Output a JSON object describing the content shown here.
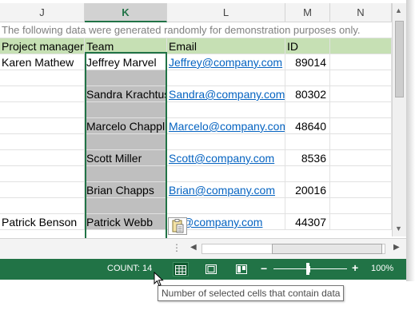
{
  "columns": [
    {
      "letter": "J",
      "selected": false
    },
    {
      "letter": "K",
      "selected": true
    },
    {
      "letter": "L",
      "selected": false
    },
    {
      "letter": "M",
      "selected": false
    },
    {
      "letter": "N",
      "selected": false
    }
  ],
  "note": "The following data were generated randomly for demonstration purposes only.",
  "headers": {
    "project_manager": "Project manager",
    "team": "Team",
    "email": "Email",
    "id": "ID"
  },
  "rows": [
    {
      "pm": "Karen Mathew",
      "team": "Jeffrey Marvel",
      "email": "Jeffrey@company.com",
      "id": "89014"
    },
    {
      "pm": "",
      "team": "",
      "email": "",
      "id": ""
    },
    {
      "pm": "",
      "team": "Sandra Krachtus",
      "email": "Sandra@company.com",
      "id": "80302"
    },
    {
      "pm": "",
      "team": "",
      "email": "",
      "id": ""
    },
    {
      "pm": "",
      "team": "Marcelo Chappl",
      "email": "Marcelo@company.com",
      "id": "48640"
    },
    {
      "pm": "",
      "team": "",
      "email": "",
      "id": ""
    },
    {
      "pm": "",
      "team": "Scott Miller",
      "email": "Scott@company.com",
      "id": "8536"
    },
    {
      "pm": "",
      "team": "",
      "email": "",
      "id": ""
    },
    {
      "pm": "",
      "team": "Brian Chapps",
      "email": "Brian@company.com",
      "id": "20016"
    },
    {
      "pm": "",
      "team": "",
      "email": "",
      "id": ""
    },
    {
      "pm": "Patrick Benson",
      "team": "Patrick Webb",
      "email": "ick@company.com",
      "id": "44307"
    }
  ],
  "status_bar": {
    "count": "COUNT: 14",
    "zoom": "100%",
    "zoom_minus": "−",
    "zoom_plus": "+",
    "accent_color": "#217346"
  },
  "tooltip": "Number of selected cells that contain data",
  "icons": {
    "normal_view": "grid-icon",
    "page_layout": "page-layout-icon",
    "page_break": "page-break-icon",
    "paste_options": "clipboard-icon"
  },
  "hscroll": {
    "dots": "⋮",
    "left_arrow": "◀",
    "right_arrow": "▶"
  },
  "vscroll": {
    "up_arrow": "▲",
    "down_arrow": "▼"
  }
}
